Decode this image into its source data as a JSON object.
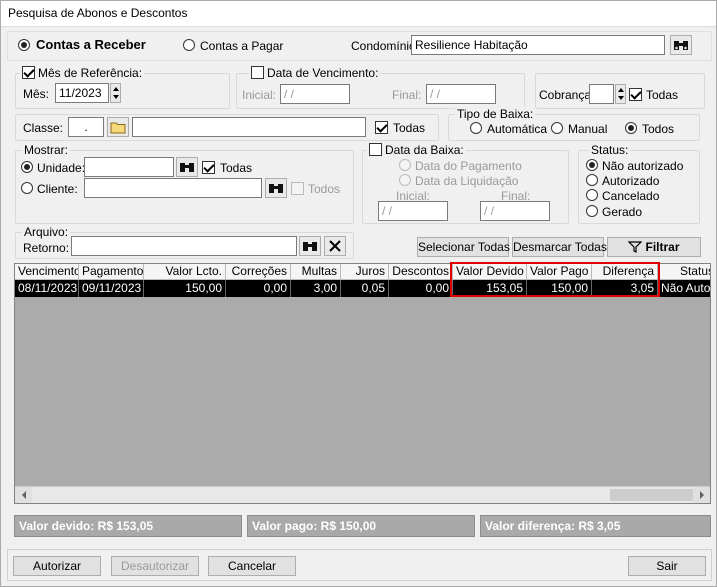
{
  "window": {
    "title": "Pesquisa de Abonos e Descontos"
  },
  "mode": {
    "receber_label": "Contas a Receber",
    "pagar_label": "Contas a Pagar",
    "selected": "receber"
  },
  "condominio": {
    "label": "Condomínio:",
    "value": "Resilience Habitação"
  },
  "mes_ref": {
    "legend": "Mês de Referência:",
    "checked": true,
    "mes_label": "Mês:",
    "mes_value": "11/2023"
  },
  "vencimento": {
    "legend": "Data de Vencimento:",
    "checked": false,
    "inicial_label": "Inicial:",
    "inicial_value": "/ /",
    "final_label": "Final:",
    "final_value": "/ /"
  },
  "cobranca": {
    "label": "Cobrança:",
    "value": "",
    "todas_label": "Todas",
    "todas_checked": true
  },
  "classe": {
    "label": "Classe:",
    "code": ".",
    "desc": "",
    "todas_label": "Todas",
    "todas_checked": true
  },
  "tipo_baixa": {
    "legend": "Tipo de Baixa:",
    "options": [
      "Automática",
      "Manual",
      "Todos"
    ],
    "selected": "Todos"
  },
  "mostrar": {
    "legend": "Mostrar:",
    "unidade_label": "Unidade:",
    "unidade_value": "",
    "unidade_todas_label": "Todas",
    "cliente_label": "Cliente:",
    "cliente_value": "",
    "cliente_todos_label": "Todos",
    "selected": "Unidade"
  },
  "data_baixa": {
    "legend": "Data da Baixa:",
    "checked": false,
    "pagamento_label": "Data do Pagamento",
    "liquidacao_label": "Data da Liquidação",
    "inicial_label": "Inicial:",
    "inicial_value": "/ /",
    "final_label": "Final:",
    "final_value": "/ /"
  },
  "status": {
    "legend": "Status:",
    "options": [
      "Não autorizado",
      "Autorizado",
      "Cancelado",
      "Gerado"
    ],
    "selected": "Não autorizado"
  },
  "arquivo": {
    "legend": "Arquivo:",
    "retorno_label": "Retorno:",
    "retorno_value": ""
  },
  "actions": {
    "selecionar": "Selecionar Todas",
    "desmarcar": "Desmarcar Todas",
    "filtrar": "Filtrar"
  },
  "table": {
    "headers": [
      "Vencimento",
      "Pagamento",
      "Valor Lcto.",
      "Correções",
      "Multas",
      "Juros",
      "Descontos",
      "Valor Devido",
      "Valor Pago",
      "Diferença",
      "Status"
    ],
    "rows": [
      [
        "08/11/2023",
        "09/11/2023",
        "150,00",
        "0,00",
        "3,00",
        "0,05",
        "0,00",
        "153,05",
        "150,00",
        "3,05",
        "Não Autori"
      ]
    ]
  },
  "summary": {
    "devido": "Valor devido: R$ 153,05",
    "pago": "Valor pago: R$ 150,00",
    "diferenca": "Valor diferença: R$ 3,05"
  },
  "footer": {
    "autorizar": "Autorizar",
    "desautorizar": "Desautorizar",
    "cancelar": "Cancelar",
    "sair": "Sair"
  },
  "colors": {
    "highlight": "#e00000",
    "selected_row": "#000000",
    "summary_bar": "#a9a9a9"
  }
}
